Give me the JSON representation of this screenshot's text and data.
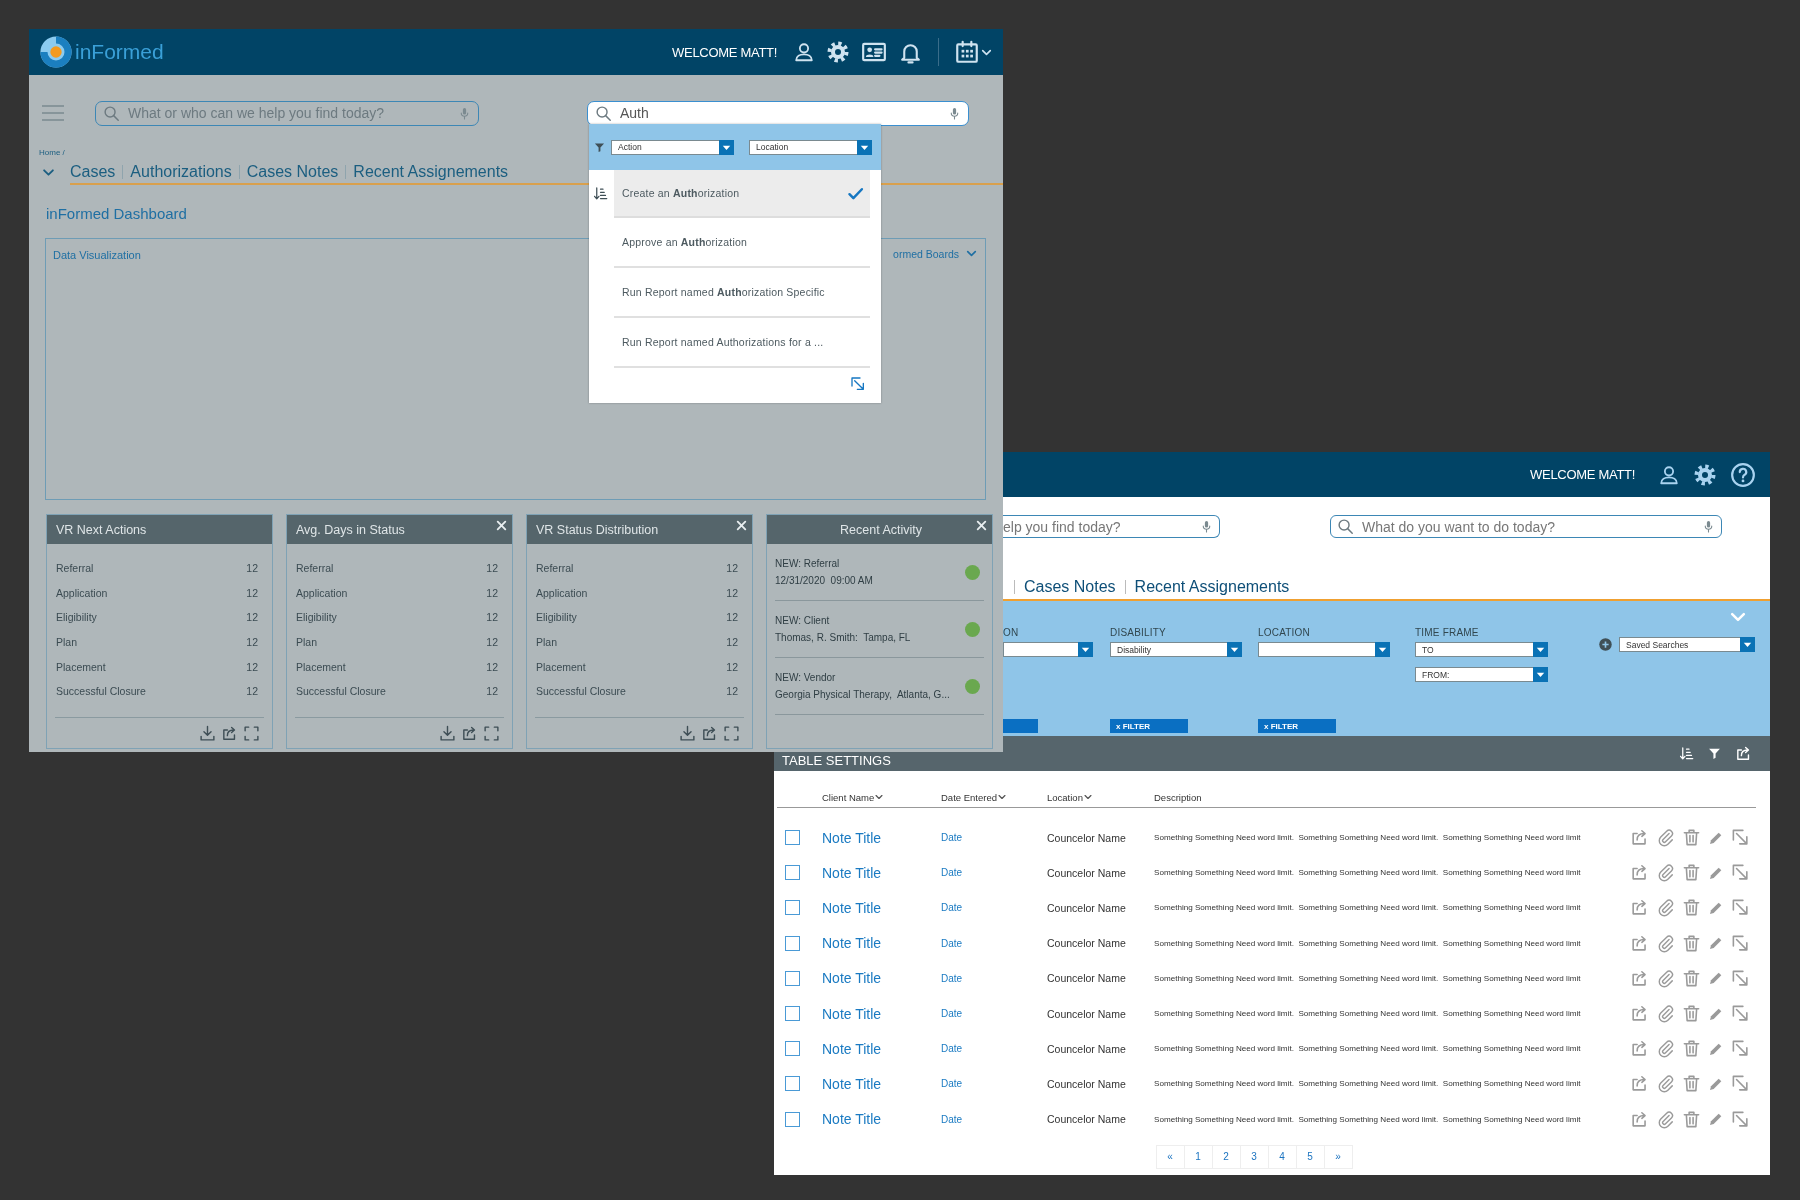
{
  "background_window": {
    "header": {
      "logo_text": "inFormed",
      "welcome": "WELCOME MATT!"
    },
    "search": {
      "placeholder": "What or who can we help you find today?"
    },
    "command_search": {
      "value": "Auth",
      "dropdown": {
        "filters": [
          {
            "kind": "text",
            "value": "Action"
          },
          {
            "kind": "text",
            "value": "Location"
          }
        ],
        "items": [
          {
            "text": "Create an **Auth**orization",
            "selected": true
          },
          {
            "text": "Approve an **Auth**orization",
            "selected": false
          },
          {
            "text": "Run Report named **Auth**orization Specific",
            "selected": false
          },
          {
            "text": "Run Report named Authorizations for a ...",
            "selected": false
          }
        ]
      }
    },
    "breadcrumb": "Home /",
    "tabs": [
      {
        "label": "Cases"
      },
      {
        "label": "Authorizations"
      },
      {
        "label": "Cases Notes"
      },
      {
        "label": "Recent Assignements"
      }
    ],
    "page_title": "inFormed Dashboard",
    "panel": {
      "title": "Data Visualization",
      "boards_menu": "ormed Boards"
    },
    "cards": [
      {
        "kind": "stats",
        "title": "VR Next Actions",
        "closable": false,
        "rows": [
          {
            "label": "Referral",
            "value": "12"
          },
          {
            "label": "Application",
            "value": "12"
          },
          {
            "label": "Eligibility",
            "value": "12"
          },
          {
            "label": "Plan",
            "value": "12"
          },
          {
            "label": "Placement",
            "value": "12"
          },
          {
            "label": "Successful Closure",
            "value": "12"
          }
        ]
      },
      {
        "kind": "stats",
        "title": "Avg. Days in Status",
        "closable": true,
        "rows": [
          {
            "label": "Referral",
            "value": "12"
          },
          {
            "label": "Application",
            "value": "12"
          },
          {
            "label": "Eligibility",
            "value": "12"
          },
          {
            "label": "Plan",
            "value": "12"
          },
          {
            "label": "Placement",
            "value": "12"
          },
          {
            "label": "Successful Closure",
            "value": "12"
          }
        ]
      },
      {
        "kind": "stats",
        "title": "VR Status Distribution",
        "closable": true,
        "rows": [
          {
            "label": "Referral",
            "value": "12"
          },
          {
            "label": "Application",
            "value": "12"
          },
          {
            "label": "Eligibility",
            "value": "12"
          },
          {
            "label": "Plan",
            "value": "12"
          },
          {
            "label": "Placement",
            "value": "12"
          },
          {
            "label": "Successful Closure",
            "value": "12"
          }
        ]
      },
      {
        "kind": "activity",
        "title": "Recent Activity",
        "closable": true,
        "items": [
          {
            "title": "NEW: Referral",
            "detail": "12/31/2020  09:00 AM",
            "color": "#6aa84f"
          },
          {
            "title": "NEW: Client",
            "detail": "Thomas, R. Smith:  Tampa, FL",
            "color": "#6aa84f"
          },
          {
            "title": "NEW: Vendor",
            "detail": "Georgia Physical Therapy,  Atlanta, G...",
            "color": "#6aa84f"
          }
        ]
      }
    ]
  },
  "foreground_window": {
    "header": {
      "welcome": "WELCOME MATT!"
    },
    "search": {
      "placeholder": "elp you find today?"
    },
    "command_search": {
      "placeholder": "What do you want to do today?"
    },
    "tabs": [
      {
        "label": "Cases Notes"
      },
      {
        "label": "Recent Assignements"
      }
    ],
    "filters": [
      {
        "label": "ON",
        "selects": [
          {
            "kind": "blank"
          }
        ],
        "chip": {
          "kind": "blank"
        }
      },
      {
        "label": "DISABILITY",
        "selects": [
          {
            "kind": "text",
            "value": "Disability"
          }
        ],
        "chip": {
          "kind": "text",
          "label": "x FILTER"
        }
      },
      {
        "label": "LOCATION",
        "selects": [
          {
            "kind": "blank"
          }
        ],
        "chip": {
          "kind": "text",
          "label": "x FILTER"
        }
      },
      {
        "label": "TIME FRAME",
        "selects": [
          {
            "kind": "text",
            "value": "TO"
          },
          {
            "kind": "text",
            "value": "FROM:"
          }
        ]
      }
    ],
    "saved_searches": {
      "kind": "text",
      "value": "Saved Searches"
    },
    "table_settings": {
      "title": "TABLE SETTINGS"
    },
    "table": {
      "columns": [
        {
          "label": "Client Name",
          "sortable": true
        },
        {
          "label": "Date Entered",
          "sortable": true
        },
        {
          "label": "Location",
          "sortable": true
        },
        {
          "label": "Description",
          "sortable": false
        }
      ],
      "rows": [
        {
          "checked": false,
          "title": "Note Title",
          "date": "Date",
          "counselor": "Councelor Name",
          "description": "Something Something Need word limit.  Something Something Need word limit.  Something Something Need word limit"
        },
        {
          "checked": false,
          "title": "Note Title",
          "date": "Date",
          "counselor": "Councelor Name",
          "description": "Something Something Need word limit.  Something Something Need word limit.  Something Something Need word limit"
        },
        {
          "checked": false,
          "title": "Note Title",
          "date": "Date",
          "counselor": "Councelor Name",
          "description": "Something Something Need word limit.  Something Something Need word limit.  Something Something Need word limit"
        },
        {
          "checked": false,
          "title": "Note Title",
          "date": "Date",
          "counselor": "Councelor Name",
          "description": "Something Something Need word limit.  Something Something Need word limit.  Something Something Need word limit"
        },
        {
          "checked": false,
          "title": "Note Title",
          "date": "Date",
          "counselor": "Councelor Name",
          "description": "Something Something Need word limit.  Something Something Need word limit.  Something Something Need word limit"
        },
        {
          "checked": false,
          "title": "Note Title",
          "date": "Date",
          "counselor": "Councelor Name",
          "description": "Something Something Need word limit.  Something Something Need word limit.  Something Something Need word limit"
        },
        {
          "checked": false,
          "title": "Note Title",
          "date": "Date",
          "counselor": "Councelor Name",
          "description": "Something Something Need word limit.  Something Something Need word limit.  Something Something Need word limit"
        },
        {
          "checked": false,
          "title": "Note Title",
          "date": "Date",
          "counselor": "Councelor Name",
          "description": "Something Something Need word limit.  Something Something Need word limit.  Something Something Need word limit"
        },
        {
          "checked": false,
          "title": "Note Title",
          "date": "Date",
          "counselor": "Councelor Name",
          "description": "Something Something Need word limit.  Something Something Need word limit.  Something Something Need word limit"
        }
      ]
    },
    "pagination": [
      "«",
      "1",
      "2",
      "3",
      "4",
      "5",
      "»"
    ]
  }
}
